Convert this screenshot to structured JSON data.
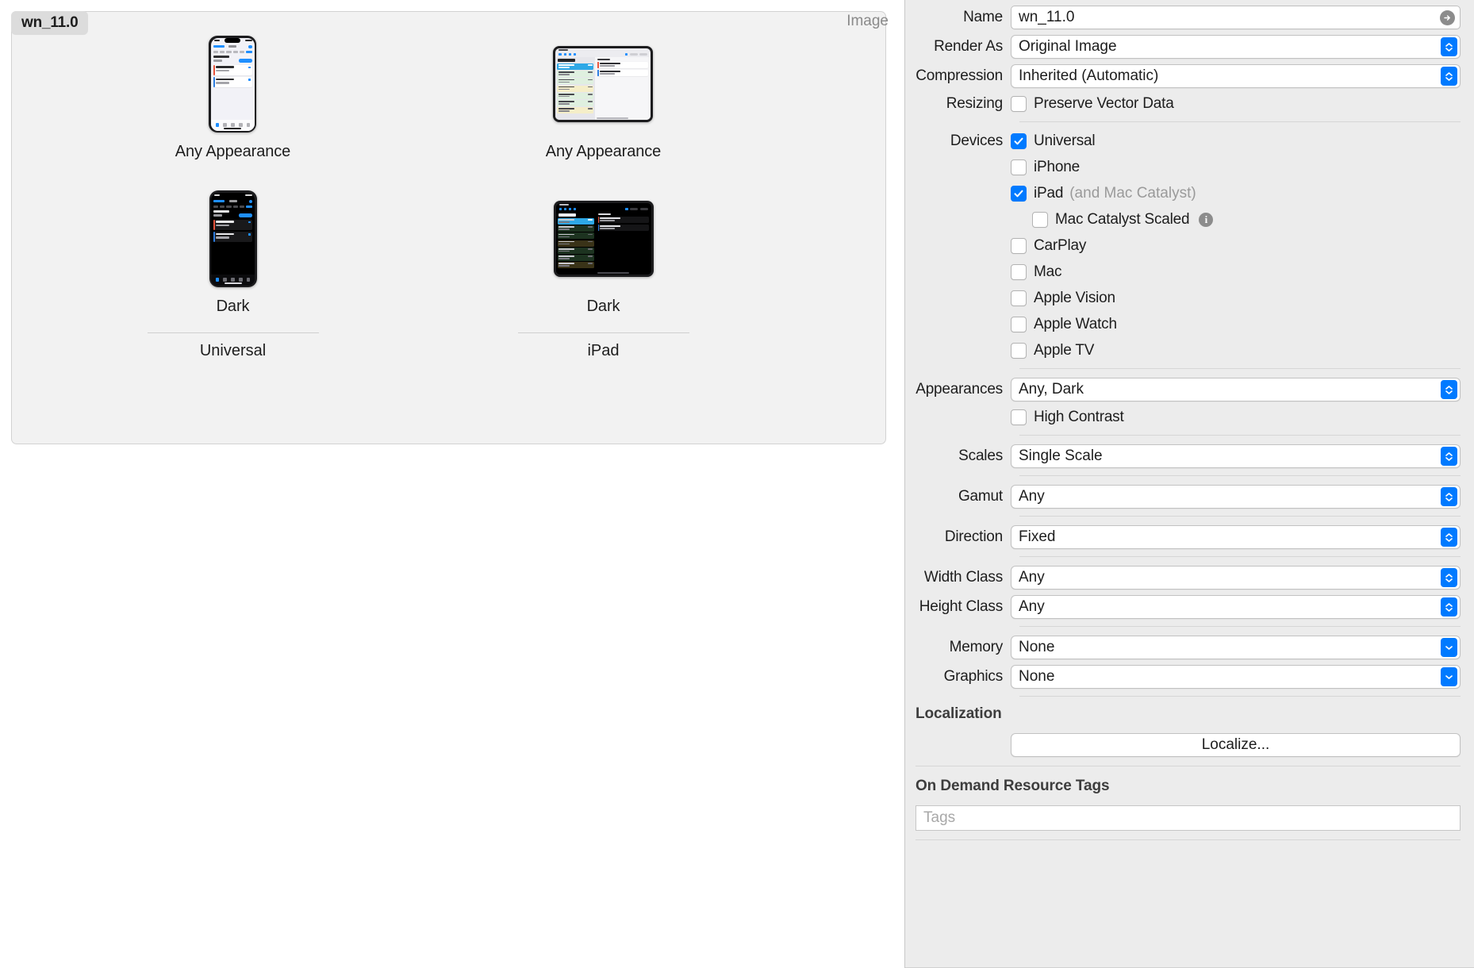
{
  "canvas": {
    "asset_name": "wn_11.0",
    "asset_kind": "Image",
    "columns": [
      {
        "name": "Universal",
        "slots": [
          {
            "appearance_label": "Any Appearance",
            "device": "iphone",
            "mode": "light"
          },
          {
            "appearance_label": "Dark",
            "device": "iphone",
            "mode": "dark"
          }
        ]
      },
      {
        "name": "iPad",
        "slots": [
          {
            "appearance_label": "Any Appearance",
            "device": "ipad",
            "mode": "light"
          },
          {
            "appearance_label": "Dark",
            "device": "ipad",
            "mode": "dark"
          }
        ]
      }
    ]
  },
  "inspector": {
    "name": {
      "label": "Name",
      "value": "wn_11.0"
    },
    "render_as": {
      "label": "Render As",
      "value": "Original Image"
    },
    "compression": {
      "label": "Compression",
      "value": "Inherited (Automatic)"
    },
    "resizing": {
      "label": "Resizing",
      "checkbox_label": "Preserve Vector Data",
      "checked": false
    },
    "devices": {
      "label": "Devices",
      "items": [
        {
          "label": "Universal",
          "checked": true,
          "sub": "",
          "indent": false,
          "info": false
        },
        {
          "label": "iPhone",
          "checked": false,
          "sub": "",
          "indent": false,
          "info": false
        },
        {
          "label": "iPad",
          "checked": true,
          "sub": "(and Mac Catalyst)",
          "indent": false,
          "info": false
        },
        {
          "label": "Mac Catalyst Scaled",
          "checked": false,
          "sub": "",
          "indent": true,
          "info": true
        },
        {
          "label": "CarPlay",
          "checked": false,
          "sub": "",
          "indent": false,
          "info": false
        },
        {
          "label": "Mac",
          "checked": false,
          "sub": "",
          "indent": false,
          "info": false
        },
        {
          "label": "Apple Vision",
          "checked": false,
          "sub": "",
          "indent": false,
          "info": false
        },
        {
          "label": "Apple Watch",
          "checked": false,
          "sub": "",
          "indent": false,
          "info": false
        },
        {
          "label": "Apple TV",
          "checked": false,
          "sub": "",
          "indent": false,
          "info": false
        }
      ]
    },
    "appearances": {
      "label": "Appearances",
      "value": "Any, Dark"
    },
    "high_contrast": {
      "checkbox_label": "High Contrast",
      "checked": false
    },
    "scales": {
      "label": "Scales",
      "value": "Single Scale"
    },
    "gamut": {
      "label": "Gamut",
      "value": "Any"
    },
    "direction": {
      "label": "Direction",
      "value": "Fixed"
    },
    "width_class": {
      "label": "Width Class",
      "value": "Any"
    },
    "height_class": {
      "label": "Height Class",
      "value": "Any"
    },
    "memory": {
      "label": "Memory",
      "value": "None"
    },
    "graphics": {
      "label": "Graphics",
      "value": "None"
    },
    "localization": {
      "heading": "Localization",
      "button_label": "Localize..."
    },
    "odr": {
      "heading": "On Demand Resource Tags",
      "tags_placeholder": "Tags"
    }
  },
  "colors": {
    "accent": "#007aff",
    "panel_bg": "#ececec",
    "canvas_bg": "#ffffff",
    "card_bg": "#f2f2f2"
  }
}
